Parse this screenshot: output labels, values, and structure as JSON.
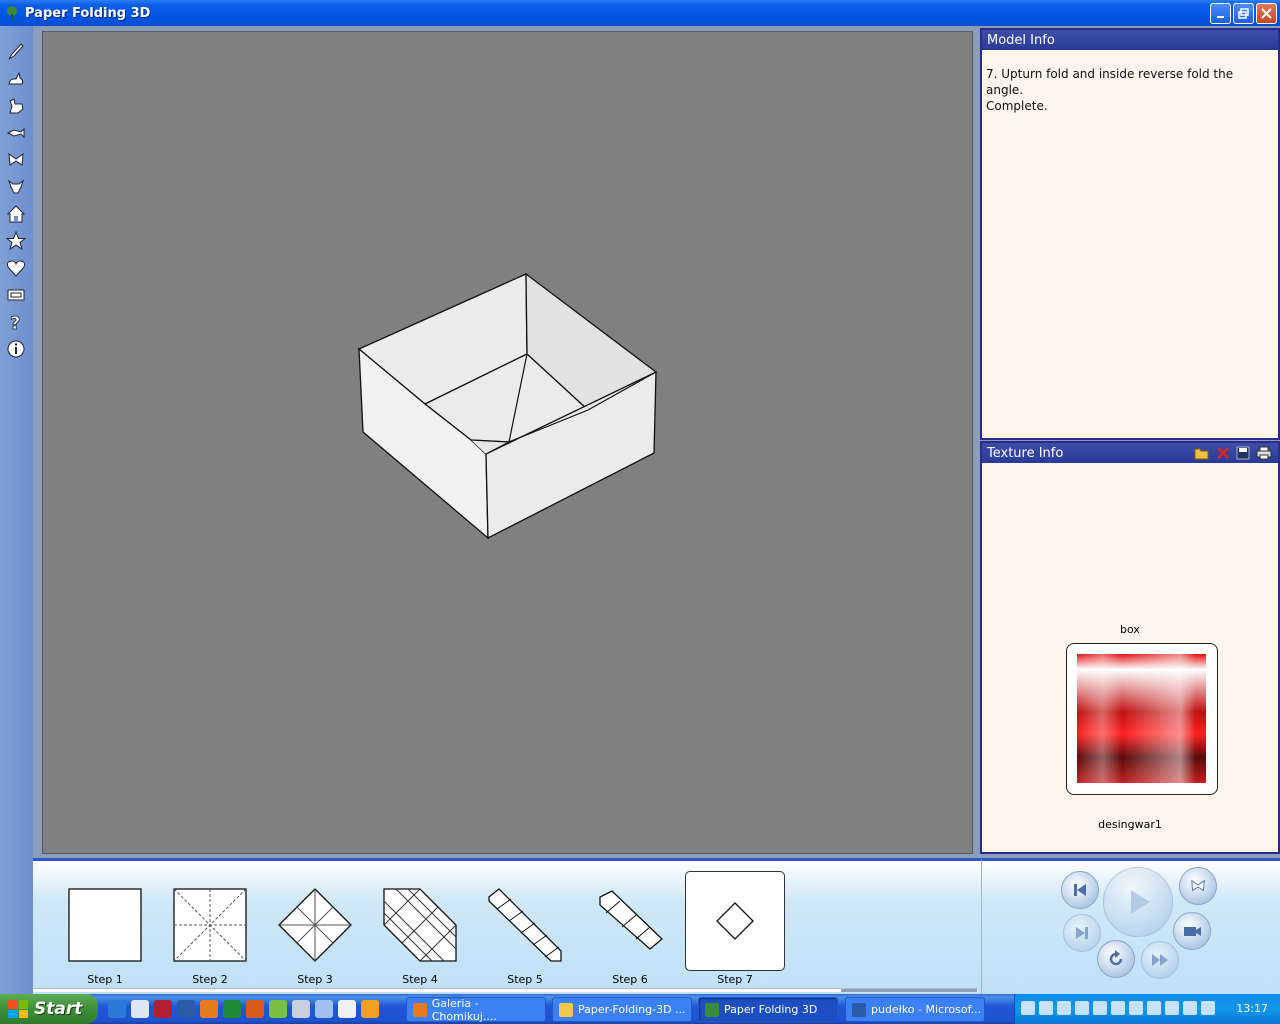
{
  "window": {
    "title": "Paper Folding 3D"
  },
  "toolbar": {
    "tools": [
      "brush-icon",
      "rabbit-icon",
      "rooster-icon",
      "fish-icon",
      "butterfly-icon",
      "bull-icon",
      "house-icon",
      "star-icon",
      "heart-icon",
      "box-icon",
      "help-icon",
      "info-icon"
    ]
  },
  "model_info": {
    "title": "Model Info",
    "text_line1": "7. Upturn fold and inside reverse fold the angle.",
    "text_line2": "Complete."
  },
  "texture_info": {
    "title": "Texture Info",
    "model_name": "box",
    "texture_name": "desingwar1"
  },
  "steps": [
    {
      "label": "Step 1"
    },
    {
      "label": "Step 2"
    },
    {
      "label": "Step 3"
    },
    {
      "label": "Step 4"
    },
    {
      "label": "Step 5"
    },
    {
      "label": "Step 6"
    },
    {
      "label": "Step 7",
      "active": true
    }
  ],
  "taskbar": {
    "start_label": "Start",
    "tasks": [
      {
        "label": "Galeria - Chomikuj...."
      },
      {
        "label": "Paper-Folding-3D ..."
      },
      {
        "label": "Paper Folding 3D"
      },
      {
        "label": "pudełko - Microsof..."
      }
    ],
    "clock": "13:17"
  },
  "colors": {
    "viewport_bg": "#808080",
    "panel_bg": "#fdf4ec",
    "panel_header": "#2b3a96"
  }
}
